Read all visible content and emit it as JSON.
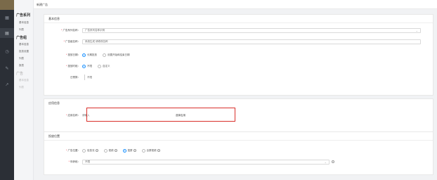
{
  "rail": {
    "icons": [
      "grid-icon",
      "document-icon",
      "clock-icon",
      "pencil-icon",
      "chart-icon"
    ]
  },
  "menu": {
    "groups": [
      {
        "title": "广告系列",
        "items": [
          "基本信息",
          "列表"
        ]
      },
      {
        "title": "广告组",
        "items": [
          "基本信息",
          "投放设置",
          "列表",
          "报表"
        ]
      },
      {
        "title": "广告",
        "items": [
          "基本信息",
          "列表"
        ]
      }
    ]
  },
  "topbar": {
    "breadcrumb": "新建广告"
  },
  "basic": {
    "header": "基本信息",
    "campaign_label": "广告系列名称：",
    "campaign_value": "广告系列名称示例",
    "group_label": "广告组名称：",
    "group_value": "系统生成 请修改名称",
    "schedule_label": "投放日期：",
    "schedule_options": [
      "长期投放",
      "设置开始和结束日期"
    ],
    "period_label": "投放时段：",
    "period_options": [
      "不限",
      "自定义"
    ],
    "budget_label": "日预算：",
    "budget_value": "不限"
  },
  "store": {
    "header": "应用信息",
    "field_label": "应用名称：",
    "field_value": "请输入",
    "action_link": "选择应用"
  },
  "placement": {
    "header": "投放位置",
    "position_label": "广告位置：",
    "position_options": [
      "信息流",
      "视频",
      "插屏",
      "全屏视频"
    ],
    "position_selected": 2,
    "age_label": "年龄段：",
    "age_value": "不限"
  }
}
